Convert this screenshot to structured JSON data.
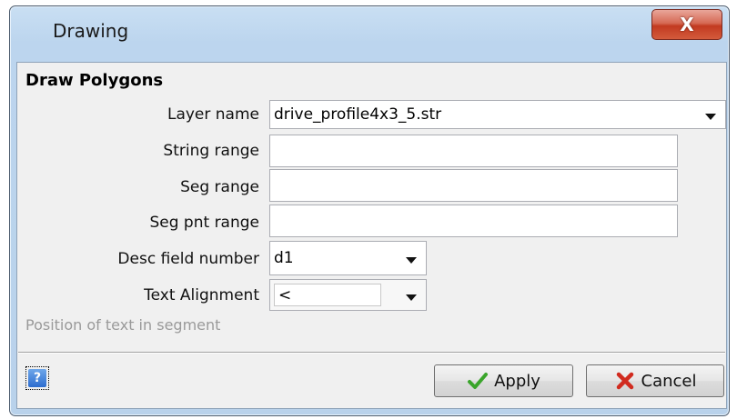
{
  "window": {
    "title": "Drawing",
    "close_label": "X"
  },
  "group": {
    "title": "Draw Polygons"
  },
  "fields": {
    "layer_name": {
      "label": "Layer name",
      "value": "drive_profile4x3_5.str"
    },
    "string_range": {
      "label": "String range",
      "value": ""
    },
    "seg_range": {
      "label": "Seg range",
      "value": ""
    },
    "seg_pnt_range": {
      "label": "Seg pnt range",
      "value": ""
    },
    "desc_field_number": {
      "label": "Desc field number",
      "value": "d1"
    },
    "text_alignment": {
      "label": "Text Alignment",
      "value": "<"
    }
  },
  "hint": "Position of text in segment",
  "buttons": {
    "help": {
      "label": "?"
    },
    "apply": {
      "label": "Apply",
      "icon": "check-icon"
    },
    "cancel": {
      "label": "Cancel",
      "icon": "x-icon"
    }
  },
  "colors": {
    "accent": "#3c7fd6",
    "apply_icon": "#3aa52b",
    "cancel_icon": "#d12b1f",
    "close_button": "#c94a30"
  }
}
